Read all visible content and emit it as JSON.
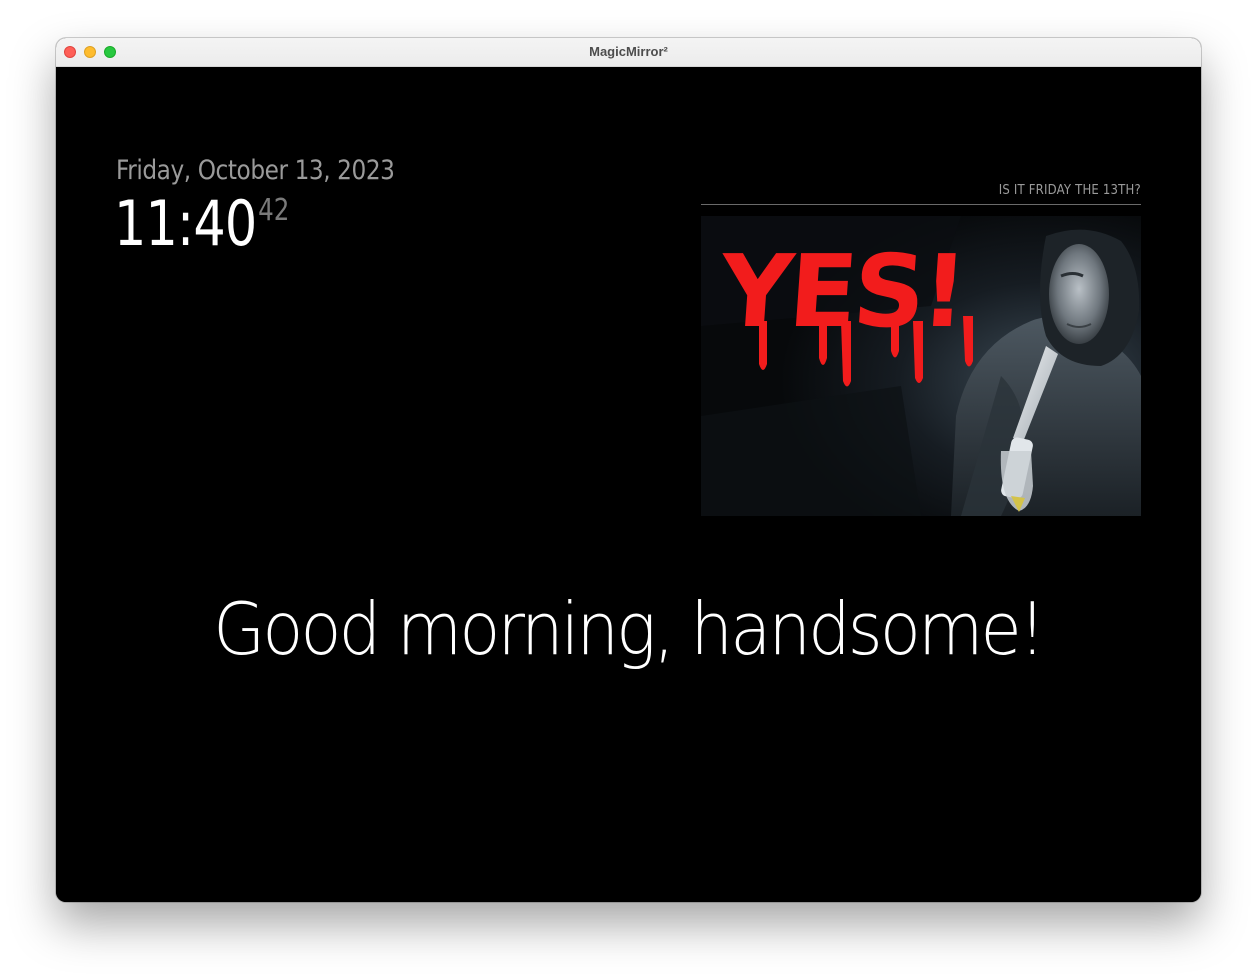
{
  "window": {
    "title": "MagicMirror²"
  },
  "clock": {
    "date": "Friday, October 13, 2023",
    "time": "11:40",
    "seconds": "42"
  },
  "friday13": {
    "header": "IS IT FRIDAY THE 13TH?",
    "answer": "YES!",
    "image": "man-with-knife-image"
  },
  "compliments": {
    "text": "Good morning, handsome!"
  },
  "colors": {
    "background": "#000000",
    "answer_red": "#f21c1c",
    "text_dim": "#9a9a9a",
    "text_bright": "#ffffff"
  }
}
